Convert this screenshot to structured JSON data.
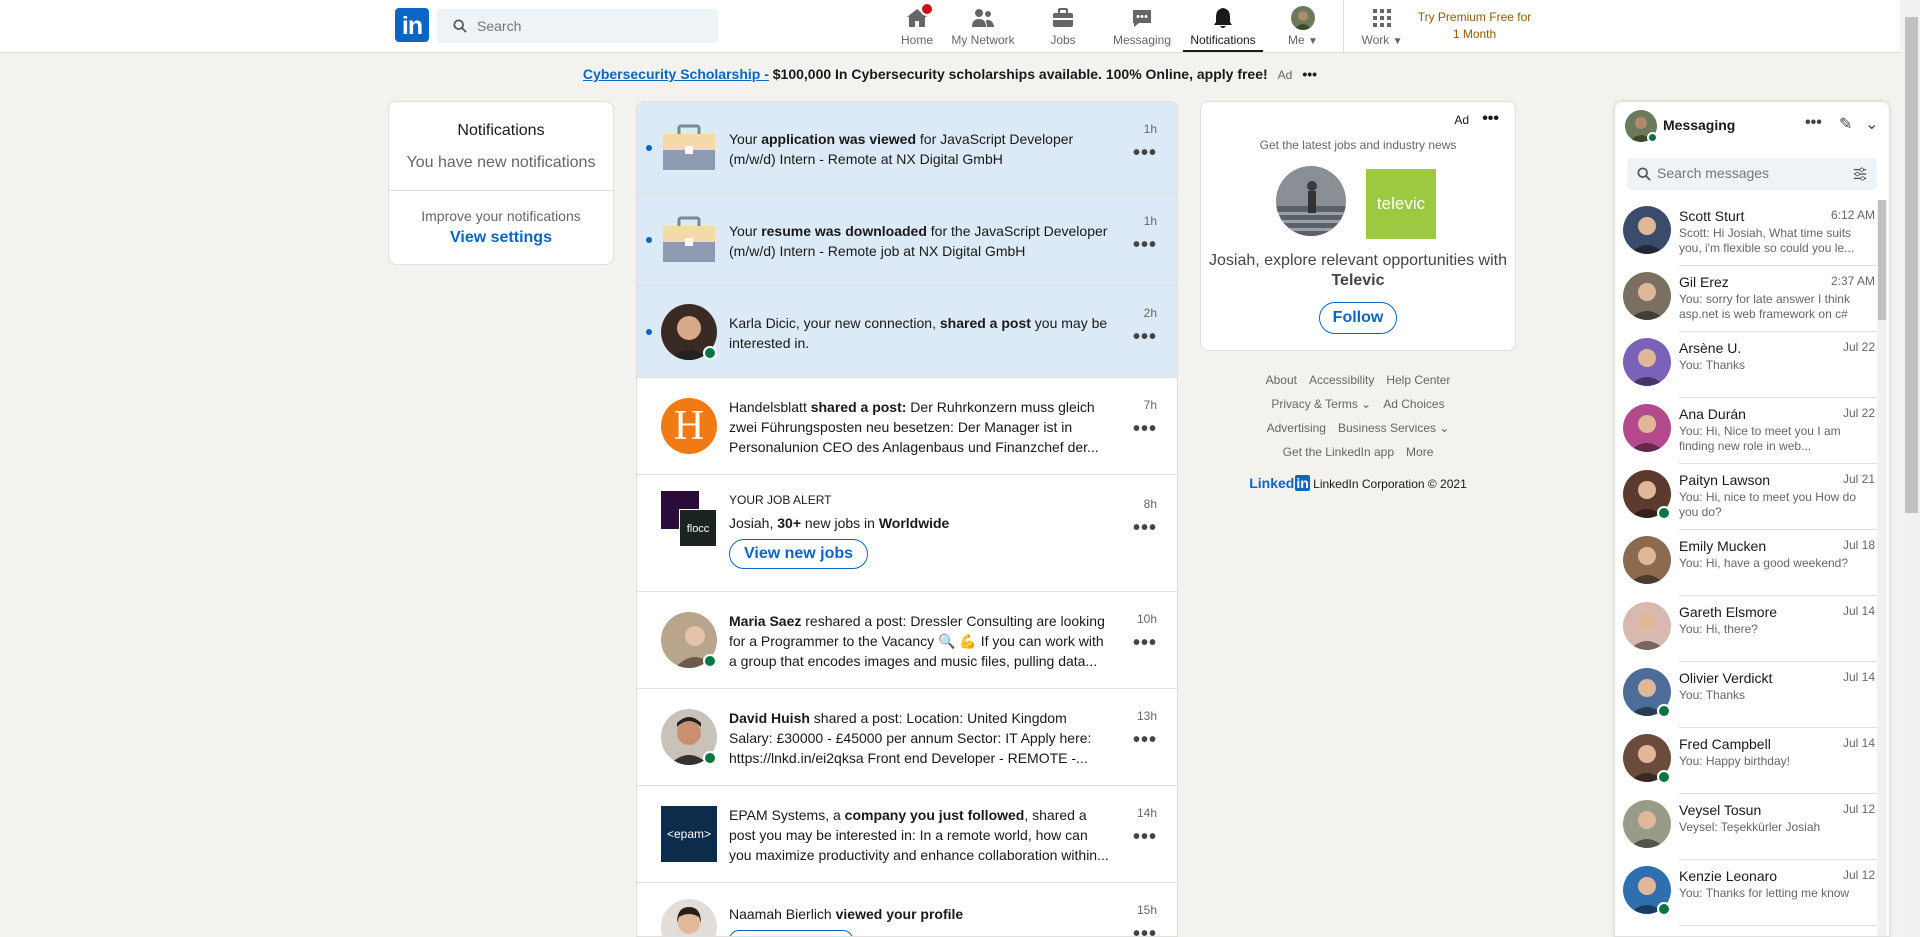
{
  "nav": {
    "logo": "in",
    "search_placeholder": "Search",
    "items": [
      {
        "label": "Home",
        "icon": "home-icon"
      },
      {
        "label": "My Network",
        "icon": "network-icon"
      },
      {
        "label": "Jobs",
        "icon": "briefcase-icon"
      },
      {
        "label": "Messaging",
        "icon": "chat-icon"
      },
      {
        "label": "Notifications",
        "icon": "bell-icon"
      },
      {
        "label": "Me",
        "icon": "avatar-icon"
      },
      {
        "label": "Work",
        "icon": "grid-icon"
      }
    ],
    "premium": "Try Premium Free for 1 Month"
  },
  "adbar": {
    "link": "Cybersecurity Scholarship -",
    "text": " $100,000 In Cybersecurity scholarships available. 100% Online, apply free!",
    "ad": "Ad",
    "dots": "•••"
  },
  "left": {
    "title": "Notifications",
    "subtitle": "You have new notifications",
    "improve": "Improve your notifications",
    "settings": "View settings"
  },
  "notifications": [
    {
      "pre": "Your ",
      "bold": "application was viewed",
      "post": " for JavaScript Developer (m/w/d) Intern - Remote at NX Digital GmbH",
      "time": "1h"
    },
    {
      "pre": "Your ",
      "bold": "resume was downloaded",
      "post": " for the JavaScript Developer (m/w/d) Intern - Remote job at NX Digital GmbH",
      "time": "1h"
    },
    {
      "pre": "Karla Dicic, your new connection, ",
      "bold": "shared a post",
      "post": " you may be interested in.",
      "time": "2h"
    },
    {
      "pre": "Handelsblatt ",
      "bold": "shared a post:",
      "post": " Der Ruhrkonzern muss gleich zwei Führungsposten neu besetzen: Der Manager ist in Personalunion CEO des Anlagenbaus und Finanzchef der...",
      "time": "7h",
      "logo": "H"
    },
    {
      "label": "YOUR JOB ALERT",
      "pre": "Josiah, ",
      "bold": "30+",
      "mid": " new jobs in ",
      "bold2": "Worldwide",
      "button": "View new jobs",
      "time": "8h",
      "logo": "flocc"
    },
    {
      "bold": "Maria Saez",
      "post": " reshared a post: Dressler Consulting are looking for a Programmer to the Vacancy 🔍 💪 If you can work with a group that encodes images and music files, pulling data...",
      "time": "10h"
    },
    {
      "bold": "David Huish",
      "post": " shared a post: Location: United Kingdom Salary: £30000 - £45000 per annum Sector: IT Apply here: https://lnkd.in/ei2qksa Front end Developer - REMOTE -...",
      "time": "13h"
    },
    {
      "pre": "EPAM Systems, a ",
      "bold": "company you just followed",
      "post": ", shared a post you may be interested in: In a remote world, how can you maximize productivity and enhance collaboration within...",
      "time": "14h",
      "logo": "<epam>"
    },
    {
      "pre": "Naamah Bierlich ",
      "bold": "viewed your profile",
      "post": "",
      "time": "15h"
    }
  ],
  "ad_card": {
    "ad": "Ad",
    "dots": "•••",
    "tagline": "Get the latest jobs and industry news",
    "logo": "televic",
    "explore": "Josiah, explore relevant opportunities with ",
    "company": "Televic",
    "follow": "Follow"
  },
  "footer": {
    "links": [
      "About",
      "Accessibility",
      "Help Center",
      "Privacy & Terms ⌄",
      "Ad Choices",
      "Advertising",
      "Business Services ⌄",
      "Get the LinkedIn app",
      "More"
    ],
    "brand": "Linked",
    "brand_in": "in",
    "copyright": " LinkedIn Corporation © 2021"
  },
  "messaging": {
    "title": "Messaging",
    "search_placeholder": "Search messages",
    "conversations": [
      {
        "name": "Scott Sturt",
        "date": "6:12 AM",
        "preview": "Scott: Hi Josiah, What time suits you, i'm flexible so could you le...",
        "online": false,
        "color": "#3a4b6b"
      },
      {
        "name": "Gil Erez",
        "date": "2:37 AM",
        "preview": "You: sorry for late answer I think asp.net is web framework on c#",
        "online": false,
        "color": "#7a6f62"
      },
      {
        "name": "Arsène U.",
        "date": "Jul 22",
        "preview": "You: Thanks",
        "online": false,
        "color": "#7b62b8"
      },
      {
        "name": "Ana Durán",
        "date": "Jul 22",
        "preview": "You: Hi, Nice to meet you I am finding new role in web...",
        "online": false,
        "color": "#b44a8a"
      },
      {
        "name": "Paityn Lawson",
        "date": "Jul 21",
        "preview": "You: Hi, nice to meet you How do you do?",
        "online": true,
        "color": "#5c3b2e"
      },
      {
        "name": "Emily Mucken",
        "date": "Jul 18",
        "preview": "You: Hi, have a good weekend?",
        "online": false,
        "color": "#8b6a4f"
      },
      {
        "name": "Gareth Elsmore",
        "date": "Jul 14",
        "preview": "You: Hi, there?",
        "online": false,
        "color": "#d9b8b0"
      },
      {
        "name": "Olivier Verdickt",
        "date": "Jul 14",
        "preview": "You: Thanks",
        "online": true,
        "color": "#4c6d9a"
      },
      {
        "name": "Fred Campbell",
        "date": "Jul 14",
        "preview": "You: Happy birthday!",
        "online": true,
        "color": "#6b4b3b"
      },
      {
        "name": "Veysel Tosun",
        "date": "Jul 12",
        "preview": "Veysel: Teşekkürler Josiah",
        "online": false,
        "color": "#9a9a8a"
      },
      {
        "name": "Kenzie Leonaro",
        "date": "Jul 12",
        "preview": "You: Thanks for letting me know",
        "online": true,
        "color": "#2f6fb0"
      }
    ]
  }
}
